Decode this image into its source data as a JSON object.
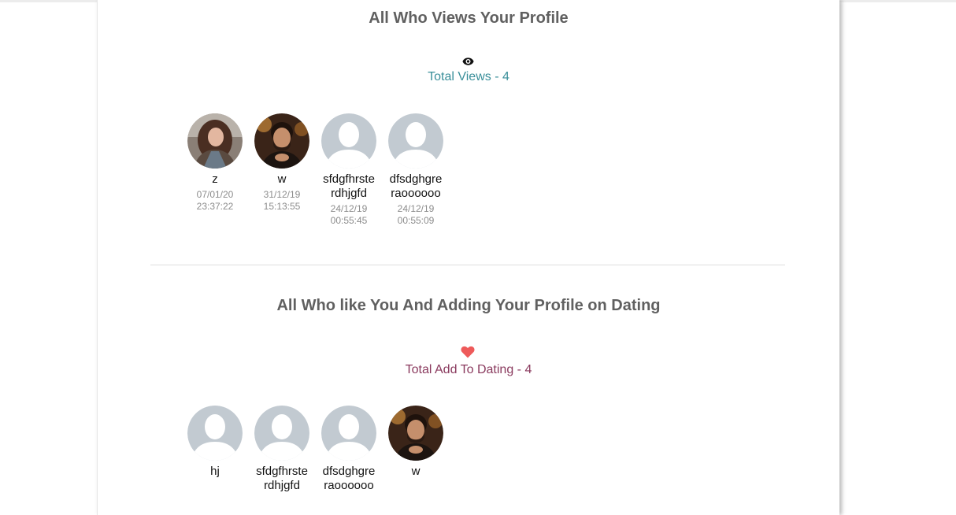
{
  "colors": {
    "views_accent": "#3a8f9a",
    "dating_accent": "#8a3a5e",
    "heart": "#ee5a5a",
    "placeholder_avatar": "#c2cad1"
  },
  "views_section": {
    "title": "All Who Views Your Profile",
    "icon": "eye-icon",
    "total_label": "Total Views - 4",
    "users": [
      {
        "name": "z",
        "avatar": "photo-woman",
        "viewed_at": "07/01/20\n23:37:22"
      },
      {
        "name": "w",
        "avatar": "photo-man",
        "viewed_at": "31/12/19\n15:13:55"
      },
      {
        "name": "sfdgfhrsterdhjgfd",
        "avatar": "default-user-avatar",
        "viewed_at": "24/12/19\n00:55:45"
      },
      {
        "name": "dfsdghgreraoooooo",
        "avatar": "default-user-avatar",
        "viewed_at": "24/12/19\n00:55:09"
      }
    ]
  },
  "dating_section": {
    "title": "All Who like You And Adding Your Profile on Dating",
    "icon": "heart-icon",
    "total_label": "Total Add To Dating - 4",
    "users": [
      {
        "name": "hj",
        "avatar": "default-user-avatar"
      },
      {
        "name": "sfdgfhrsterdhjgfd",
        "avatar": "default-user-avatar"
      },
      {
        "name": "dfsdghgreraoooooo",
        "avatar": "default-user-avatar"
      },
      {
        "name": "w",
        "avatar": "photo-man"
      }
    ]
  }
}
